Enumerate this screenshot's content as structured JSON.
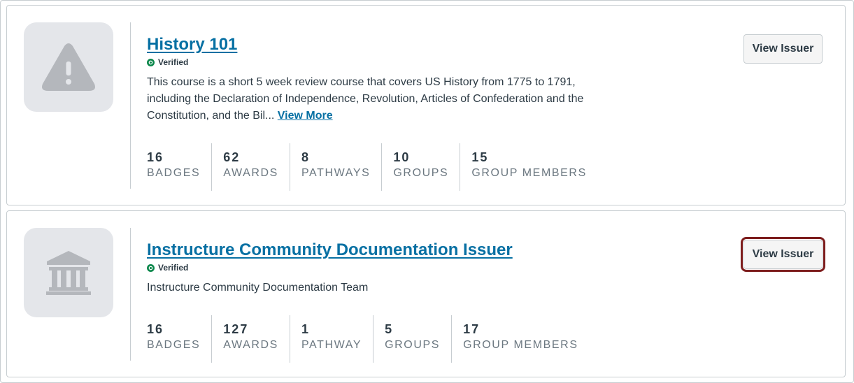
{
  "verified_label": "Verified",
  "button_label": "View Issuer",
  "issuers": [
    {
      "name": "History 101",
      "icon": "warning-icon",
      "description": "This course is a short 5 week review course that covers US History from 1775 to 1791, including the Declaration of Independence, Revolution, Articles of Confederation and the Constitution, and the Bil...",
      "view_more": "View More",
      "stats": [
        {
          "value": "16",
          "label": "BADGES"
        },
        {
          "value": "62",
          "label": "AWARDS"
        },
        {
          "value": "8",
          "label": "PATHWAYS"
        },
        {
          "value": "10",
          "label": "GROUPS"
        },
        {
          "value": "15",
          "label": "GROUP MEMBERS"
        }
      ]
    },
    {
      "name": "Instructure Community Documentation Issuer",
      "icon": "institution-icon",
      "description": "Instructure Community Documentation Team",
      "stats": [
        {
          "value": "16",
          "label": "BADGES"
        },
        {
          "value": "127",
          "label": "AWARDS"
        },
        {
          "value": "1",
          "label": "PATHWAY"
        },
        {
          "value": "5",
          "label": "GROUPS"
        },
        {
          "value": "17",
          "label": "GROUP MEMBERS"
        }
      ]
    }
  ],
  "colors": {
    "link": "#0770a3",
    "verified": "#0b874b",
    "focus_ring": "#7d1d1d",
    "icon_tile": "#e4e6ea",
    "icon_glyph": "#b4b7bc"
  }
}
